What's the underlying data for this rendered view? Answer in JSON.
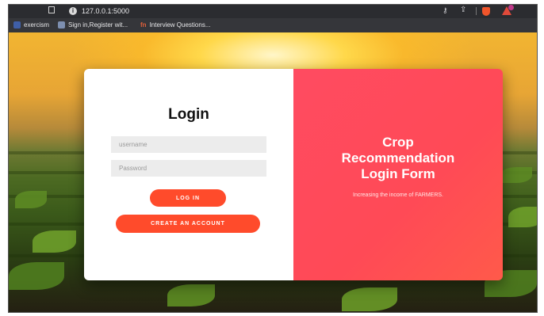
{
  "browser": {
    "url": "127.0.0.1:5000",
    "bookmarks": [
      {
        "label": "exercism",
        "icon": "exercism-icon",
        "color": "#3f5fa8"
      },
      {
        "label": "Sign in,Register wit...",
        "icon": "bookmark-site-icon",
        "color": "#7d8fb0"
      },
      {
        "label": "Interview Questions...",
        "icon": "interview-site-icon",
        "color": "#e2613b"
      }
    ],
    "bookmark_glyphs": [
      "",
      "",
      "fn"
    ]
  },
  "login": {
    "title": "Login",
    "username_placeholder": "username",
    "password_placeholder": "Password",
    "login_button": "LOG IN",
    "create_account_button": "CREATE AN ACCOUNT",
    "button_color": "#ff4b2b"
  },
  "hero": {
    "title_line1": "Crop",
    "title_line2": "Recommendation",
    "title_line3": "Login Form",
    "subtitle": "Increasing the income of FARMERS.",
    "panel_color": "#ff4b5c"
  }
}
